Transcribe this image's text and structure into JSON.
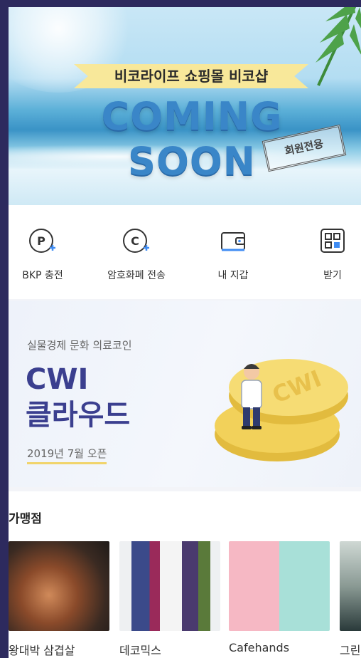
{
  "banner": {
    "ribbon": "비코라이프 쇼핑몰 비코샵",
    "headline": "COMING SOON",
    "stamp": "회원전용"
  },
  "actions": [
    {
      "label": "BKP 충전",
      "icon": "bkp-charge-icon"
    },
    {
      "label": "암호화폐 전송",
      "icon": "crypto-send-icon"
    },
    {
      "label": "내 지갑",
      "icon": "wallet-icon"
    },
    {
      "label": "받기",
      "icon": "qr-receive-icon"
    }
  ],
  "promo": {
    "subtitle": "실물경제 문화 의료코인",
    "title_line1": "CWI",
    "title_line2": "클라우드",
    "date": "2019년 7월 오픈",
    "coin_text": "CWI"
  },
  "shops": {
    "title": "가맹점",
    "items": [
      {
        "name": "왕대박 삼겹살"
      },
      {
        "name": "데코믹스"
      },
      {
        "name": "Cafehands"
      },
      {
        "name": "그린"
      }
    ]
  },
  "colors": {
    "accent": "#3b3f8f",
    "frame_bg": "#2d2a5e",
    "coin": "#f2d15a"
  }
}
